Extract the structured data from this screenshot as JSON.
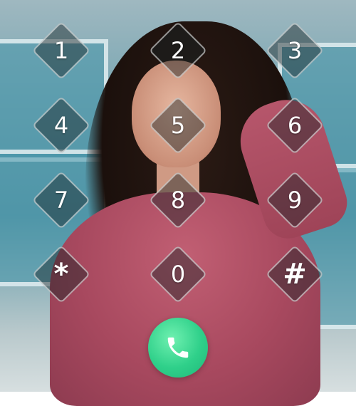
{
  "wallpaper": {
    "subject": "photo-background",
    "accent_pink": "#b4526a"
  },
  "keypad": {
    "keys": [
      {
        "label": "1"
      },
      {
        "label": "2"
      },
      {
        "label": "3"
      },
      {
        "label": "4"
      },
      {
        "label": "5"
      },
      {
        "label": "6"
      },
      {
        "label": "7"
      },
      {
        "label": "8"
      },
      {
        "label": "9"
      },
      {
        "label": "*"
      },
      {
        "label": "0"
      },
      {
        "label": "#"
      }
    ]
  },
  "call": {
    "icon": "phone-icon",
    "color": "#2fd08a"
  }
}
